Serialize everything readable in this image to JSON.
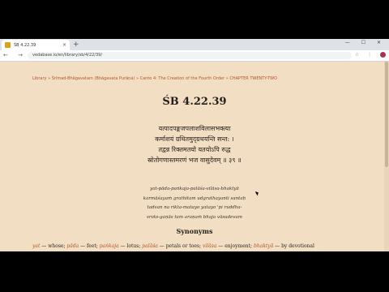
{
  "browser": {
    "tab_title": "ŚB 4.22.39",
    "tab_close": "×",
    "new_tab": "+",
    "window_controls": "— ☐ ✕",
    "nav_icons": "← → ⟳",
    "url": "vedabase.io/en/library/sb/4/22/39/",
    "addr_icons": "☆ ⋮"
  },
  "page": {
    "breadcrumb": "Library » Śrīmad-Bhāgavatam (Bhāgavata Purāṇa) » Canto 4: The Creation of the Fourth Order » CHAPTER TWENTY-TWO",
    "title": "ŚB 4.22.39",
    "verse": [
      "यत्पादपङ्कजपलाशविलासभक्त्या",
      "कर्माशयं ग्रथितमुद्ग्रथयन्ति सन्त: ।",
      "तद्वन्न रिक्तमतयो यतयोऽपि रुद्ध",
      "स्रोतोगणास्तमरणं भज वासुदेवम् ॥ ३९ ॥"
    ],
    "transliteration": [
      "yat-pāda-paṅkaja-palāśa-vilāsa-bhaktyā",
      "karmāśayaṁ grathitam udgrathayanti santaḥ",
      "tadvan na rikta-matayo yatayo 'pi ruddha-",
      "sroto-gaṇās tam araṇaṁ bhaja vāsudevam"
    ],
    "synonyms_heading": "Synonyms",
    "synonyms": [
      {
        "word": "yat",
        "meaning": " — whose; "
      },
      {
        "word": "pāda",
        "meaning": " — feet; "
      },
      {
        "word": "paṅkaja",
        "meaning": " — lotus; "
      },
      {
        "word": "palāśa",
        "meaning": " — petals or toes; "
      },
      {
        "word": "vilāsa",
        "meaning": " — enjoyment; "
      },
      {
        "word": "bhaktyā",
        "meaning": " — by devotional"
      }
    ]
  }
}
